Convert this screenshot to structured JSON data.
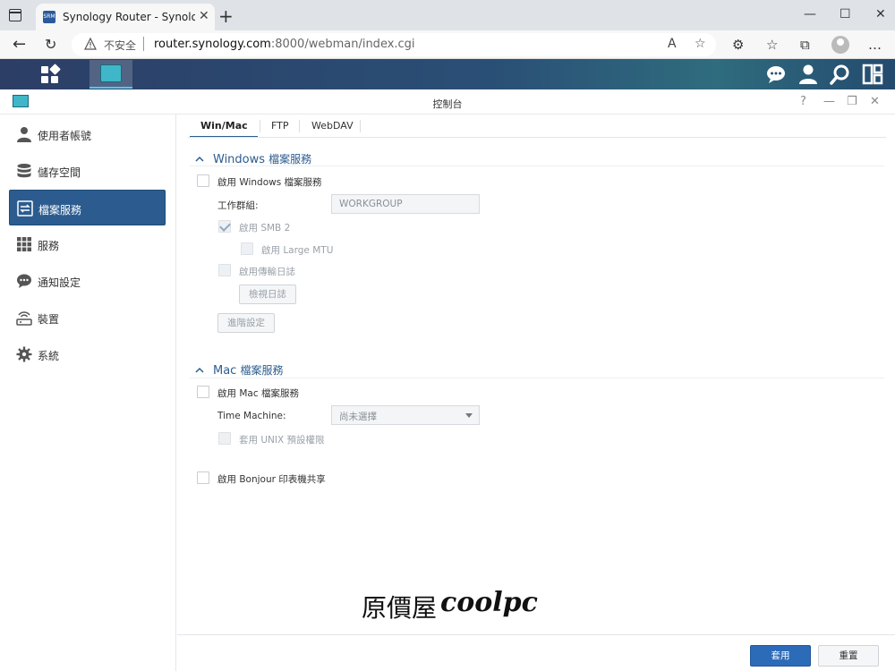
{
  "browser": {
    "tab_title": "Synology Router - SynologyRouter",
    "tab_favicon_text": "SRM",
    "new_tab_symbol": "+",
    "close_symbol": "✕",
    "insecure_label": "不安全",
    "url_host": "router.synology.com",
    "url_path": ":8000/webman/index.cgi"
  },
  "window": {
    "title": "控制台"
  },
  "sidebar": {
    "items": [
      {
        "label": "使用者帳號",
        "icon": "user-icon"
      },
      {
        "label": "儲存空間",
        "icon": "storage-icon"
      },
      {
        "label": "檔案服務",
        "icon": "file-services-icon",
        "active": true
      },
      {
        "label": "服務",
        "icon": "services-grid-icon"
      },
      {
        "label": "通知設定",
        "icon": "notification-bubble-icon"
      },
      {
        "label": "裝置",
        "icon": "device-router-icon"
      },
      {
        "label": "系統",
        "icon": "gear-icon"
      }
    ]
  },
  "tabs": [
    {
      "label": "Win/Mac",
      "active": true
    },
    {
      "label": "FTP"
    },
    {
      "label": "WebDAV"
    }
  ],
  "windows": {
    "header_prefix": "Windows",
    "header_suffix": "檔案服務",
    "enable_label": "啟用 Windows 檔案服務",
    "workgroup_label": "工作群組:",
    "workgroup_value": "WORKGROUP",
    "smb2_label": "啟用 SMB 2",
    "large_mtu_label": "啟用 Large MTU",
    "transfer_log_label": "啟用傳輸日誌",
    "view_log_button": "檢視日誌",
    "advanced_button": "進階設定"
  },
  "mac": {
    "header_prefix": "Mac",
    "header_suffix": "檔案服務",
    "enable_label": "啟用 Mac 檔案服務",
    "time_machine_label": "Time Machine:",
    "time_machine_value": "尚未選擇",
    "unix_label": "套用 UNIX 預設權限"
  },
  "bonjour": {
    "label": "啟用 Bonjour 印表機共享"
  },
  "footer": {
    "apply": "套用",
    "reset": "重置"
  },
  "watermark": {
    "chinese": "原價屋",
    "english": "coolpc"
  },
  "colors": {
    "accent": "#2c5c8f",
    "primary_button": "#2c6bb8"
  }
}
